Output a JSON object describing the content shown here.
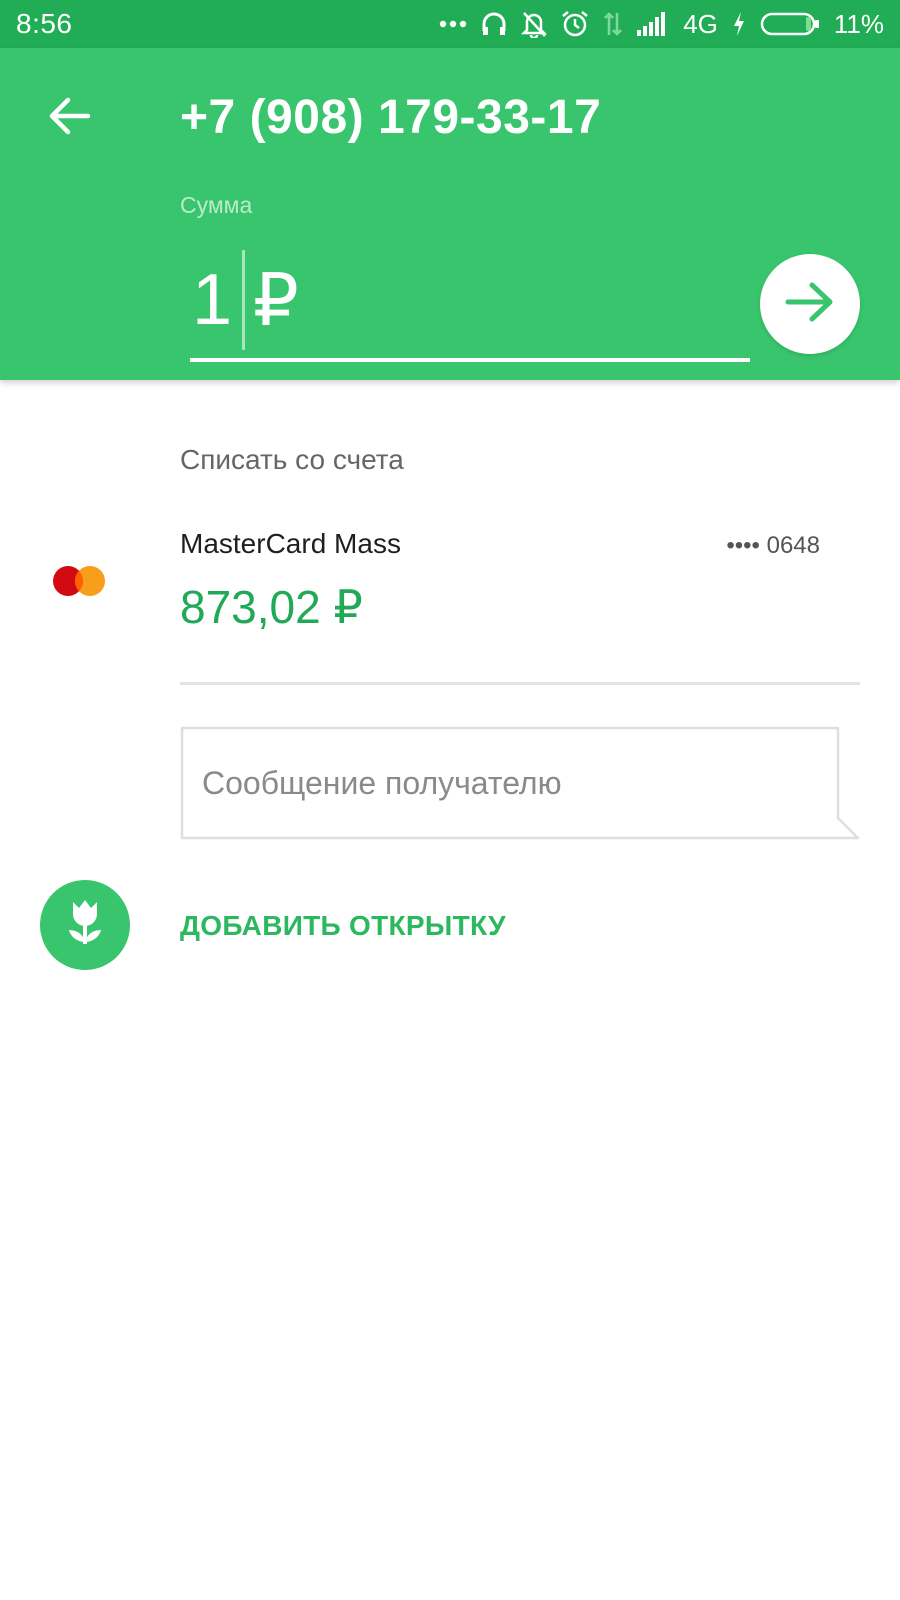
{
  "status_bar": {
    "time": "8:56",
    "network": "4G",
    "battery": "11%",
    "icons": [
      "more-dots-icon",
      "headphones-icon",
      "bell-off-icon",
      "alarm-icon",
      "data-arrows-icon",
      "signal-icon",
      "charging-icon",
      "battery-icon"
    ]
  },
  "header": {
    "title": "+7 (908) 179-33-17",
    "amount_caption": "Сумма",
    "amount_value": "1",
    "currency": "₽"
  },
  "account_section": {
    "label": "Списать со счета",
    "card_name": "MasterCard Mass",
    "card_mask": "•••• 0648",
    "balance": "873,02 ₽"
  },
  "message": {
    "placeholder": "Сообщение получателю",
    "value": ""
  },
  "postcard": {
    "label": "ДОБАВИТЬ ОТКРЫТКУ"
  },
  "colors": {
    "status_bar": "#21ad55",
    "header": "#38c56d",
    "accent": "#21a957",
    "mastercard_red": "#d20a11",
    "mastercard_orange": "#f79e1b"
  }
}
